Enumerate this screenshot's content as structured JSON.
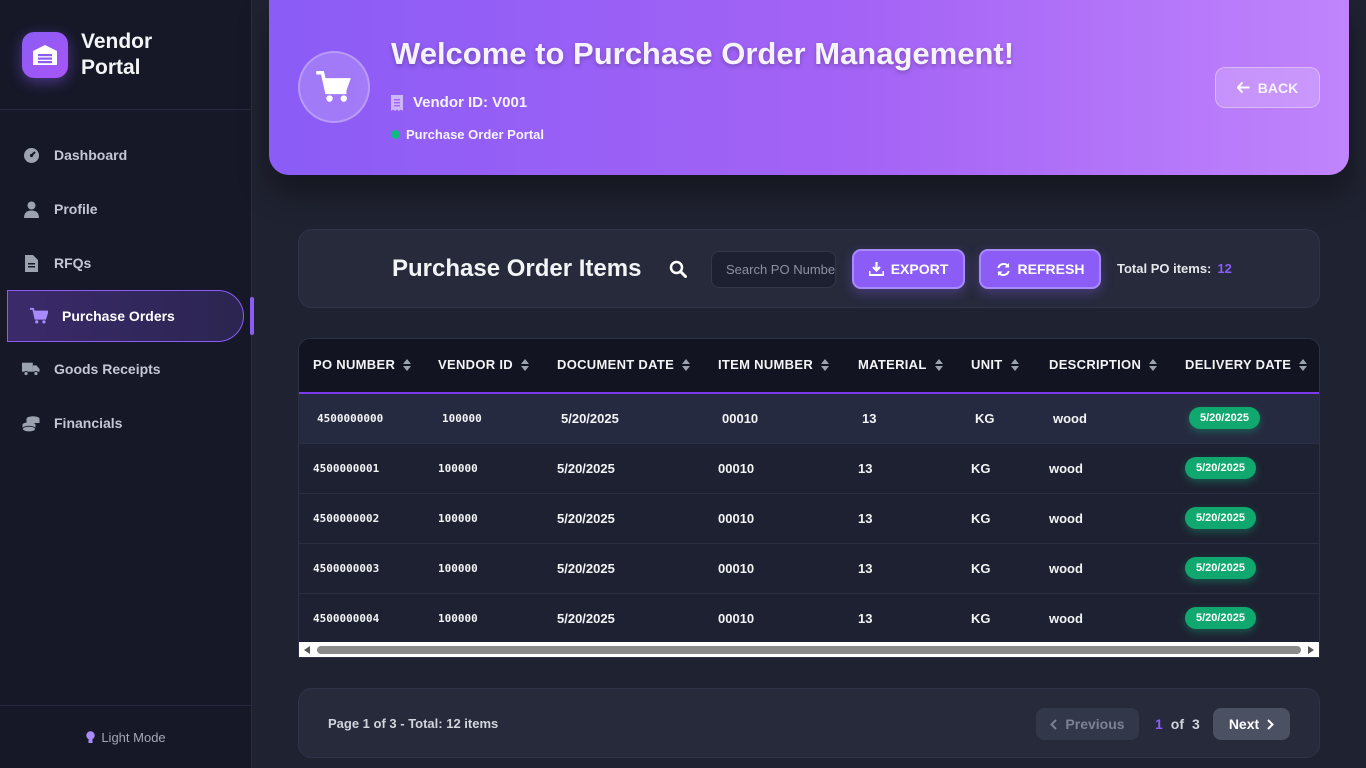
{
  "sidebar": {
    "brand_line1": "Vendor",
    "brand_line2": "Portal",
    "items": [
      {
        "label": "Dashboard",
        "icon": "dashboard-gauge-icon"
      },
      {
        "label": "Profile",
        "icon": "user-icon"
      },
      {
        "label": "RFQs",
        "icon": "document-icon"
      },
      {
        "label": "Purchase Orders",
        "icon": "cart-icon",
        "active": true
      },
      {
        "label": "Goods Receipts",
        "icon": "truck-icon"
      },
      {
        "label": "Financials",
        "icon": "coins-icon"
      }
    ],
    "footer_label": "Light Mode"
  },
  "hero": {
    "title": "Welcome to Purchase Order Management!",
    "vendor_id": "Vendor ID: V001",
    "subtitle": "Purchase Order Portal",
    "back_label": "BACK"
  },
  "toolbar": {
    "title": "Purchase Order Items",
    "search_placeholder": "Search PO Number",
    "export_label": "EXPORT",
    "refresh_label": "REFRESH",
    "total_label": "Total PO items:",
    "total_value": "12"
  },
  "table": {
    "columns": [
      "PO NUMBER",
      "VENDOR ID",
      "DOCUMENT DATE",
      "ITEM NUMBER",
      "MATERIAL",
      "UNIT",
      "DESCRIPTION",
      "DELIVERY DATE"
    ],
    "rows": [
      [
        "4500000000",
        "100000",
        "5/20/2025",
        "00010",
        "13",
        "KG",
        "wood",
        "5/20/2025"
      ],
      [
        "4500000001",
        "100000",
        "5/20/2025",
        "00010",
        "13",
        "KG",
        "wood",
        "5/20/2025"
      ],
      [
        "4500000002",
        "100000",
        "5/20/2025",
        "00010",
        "13",
        "KG",
        "wood",
        "5/20/2025"
      ],
      [
        "4500000003",
        "100000",
        "5/20/2025",
        "00010",
        "13",
        "KG",
        "wood",
        "5/20/2025"
      ],
      [
        "4500000004",
        "100000",
        "5/20/2025",
        "00010",
        "13",
        "KG",
        "wood",
        "5/20/2025"
      ]
    ]
  },
  "pagination": {
    "info": "Page 1 of 3 - Total: 12 items",
    "prev_label": "Previous",
    "current_page": "1",
    "of_label": "of",
    "total_pages": "3",
    "next_label": "Next"
  },
  "colors": {
    "accent": "#8b5cf6",
    "success": "#10a86f",
    "background": "#1f2230",
    "sidebar": "#161828"
  }
}
